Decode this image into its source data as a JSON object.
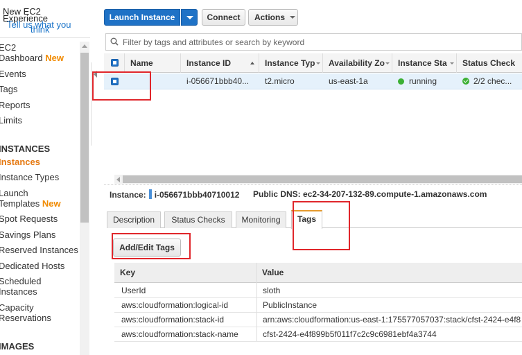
{
  "sidebar": {
    "header_line1": "New EC2",
    "header_line2": "Experience",
    "tell_us": "Tell us what you",
    "think": "think",
    "items": [
      {
        "label": "EC2",
        "badge": ""
      },
      {
        "label": "Dashboard",
        "badge": "New"
      },
      {
        "label": "Events",
        "badge": ""
      },
      {
        "label": "Tags",
        "badge": ""
      },
      {
        "label": "Reports",
        "badge": ""
      },
      {
        "label": "Limits",
        "badge": ""
      }
    ],
    "instances_section": "INSTANCES",
    "instance_items": [
      {
        "label": "Instances",
        "badge": ""
      },
      {
        "label": "Instance Types",
        "badge": ""
      },
      {
        "label": "Launch",
        "badge": ""
      },
      {
        "label": "Templates",
        "badge": "New"
      },
      {
        "label": "Spot Requests",
        "badge": ""
      },
      {
        "label": "Savings Plans",
        "badge": ""
      },
      {
        "label": "Reserved Instances",
        "badge": ""
      },
      {
        "label": "Dedicated Hosts",
        "badge": ""
      },
      {
        "label": "Scheduled",
        "badge": ""
      },
      {
        "label": "Instances",
        "badge": ""
      },
      {
        "label": "Capacity",
        "badge": ""
      },
      {
        "label": "Reservations",
        "badge": ""
      }
    ],
    "images_section": "IMAGES"
  },
  "toolbar": {
    "launch_label": "Launch Instance",
    "connect_label": "Connect",
    "actions_label": "Actions"
  },
  "search": {
    "placeholder": "Filter by tags and attributes or search by keyword"
  },
  "instances_table": {
    "columns": [
      "Name",
      "Instance ID",
      "Instance Typ",
      "Availability Zo",
      "Instance Sta",
      "Status Check"
    ],
    "rows": [
      {
        "name": "",
        "instance_id": "i-056671bbb40...",
        "instance_type": "t2.micro",
        "az": "us-east-1a",
        "state": "running",
        "status_check": "2/2 chec..."
      }
    ]
  },
  "detail": {
    "instance_label": "Instance:",
    "instance_id": "i-056671bbb40710012",
    "dns_label": "Public DNS:",
    "dns_value": "ec2-34-207-132-89.compute-1.amazonaws.com",
    "tabs": [
      "Description",
      "Status Checks",
      "Monitoring",
      "Tags"
    ],
    "active_tab": "Tags",
    "add_edit_label": "Add/Edit Tags",
    "tags_columns": [
      "Key",
      "Value"
    ],
    "tags": [
      {
        "key": "UserId",
        "value": "sloth"
      },
      {
        "key": "aws:cloudformation:logical-id",
        "value": "PublicInstance"
      },
      {
        "key": "aws:cloudformation:stack-id",
        "value": "arn:aws:cloudformation:us-east-1:175577057037:stack/cfst-2424-e4f8"
      },
      {
        "key": "aws:cloudformation:stack-name",
        "value": "cfst-2424-e4f899b5f011f7c2c9c6981ebf4a3744"
      }
    ]
  },
  "colors": {
    "accent": "#1f72c6",
    "new_badge": "#f08a00",
    "running": "#3cb034",
    "annotation": "#e0262b"
  }
}
